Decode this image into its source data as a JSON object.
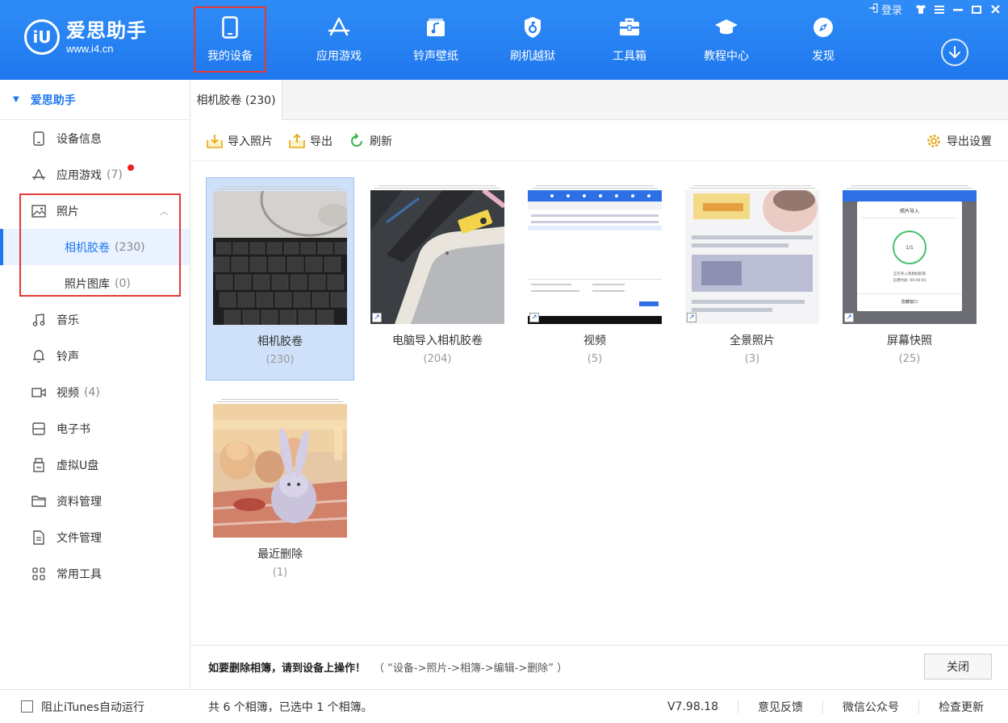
{
  "brand": {
    "name": "爱思助手",
    "url": "www.i4.cn",
    "mark": "iU"
  },
  "window": {
    "login": "登录"
  },
  "nav": [
    {
      "label": "我的设备",
      "icon": "phone-icon"
    },
    {
      "label": "应用游戏",
      "icon": "app-store-icon"
    },
    {
      "label": "铃声壁纸",
      "icon": "music-folder-icon"
    },
    {
      "label": "刷机越狱",
      "icon": "shield-key-icon"
    },
    {
      "label": "工具箱",
      "icon": "toolbox-icon"
    },
    {
      "label": "教程中心",
      "icon": "graduation-cap-icon"
    },
    {
      "label": "发现",
      "icon": "compass-icon"
    }
  ],
  "sidebar": {
    "head": "爱思助手",
    "items": [
      {
        "label": "设备信息"
      },
      {
        "label": "应用游戏",
        "count": "(7)"
      },
      {
        "label": "照片"
      },
      {
        "label": "音乐"
      },
      {
        "label": "铃声"
      },
      {
        "label": "视频",
        "count": "(4)"
      },
      {
        "label": "电子书"
      },
      {
        "label": "虚拟U盘"
      },
      {
        "label": "资料管理"
      },
      {
        "label": "文件管理"
      },
      {
        "label": "常用工具"
      }
    ],
    "photo_sub": [
      {
        "label": "相机胶卷",
        "count": "(230)"
      },
      {
        "label": "照片图库",
        "count": "(0)"
      }
    ]
  },
  "tab": {
    "label": "相机胶卷 (230)"
  },
  "toolbar": {
    "import": "导入照片",
    "export": "导出",
    "refresh": "刷新",
    "export_settings": "导出设置"
  },
  "albums": [
    {
      "name": "相机胶卷",
      "count": "(230)"
    },
    {
      "name": "电脑导入相机胶卷",
      "count": "(204)"
    },
    {
      "name": "视频",
      "count": "(5)"
    },
    {
      "name": "全景照片",
      "count": "(3)"
    },
    {
      "name": "屏幕快照",
      "count": "(25)"
    },
    {
      "name": "最近删除",
      "count": "(1)"
    }
  ],
  "tip": {
    "bold": "如要删除相簿，请到设备上操作！",
    "path": "（ “设备->照片->相簿->编辑->删除” ）",
    "close": "关闭"
  },
  "status": {
    "itunes": "阻止iTunes自动运行",
    "summary": "共 6 个相簿，已选中 1 个相簿。",
    "version": "V7.98.18",
    "feedback": "意见反馈",
    "wechat": "微信公众号",
    "update": "检查更新"
  },
  "screenshot_thumbs": {
    "import_title": "照片导入",
    "progress": "1/1",
    "importing": "正在导入到相机胶卷",
    "elapsed": "已用时间: 00:00:01",
    "hide": "隐藏窗口"
  }
}
